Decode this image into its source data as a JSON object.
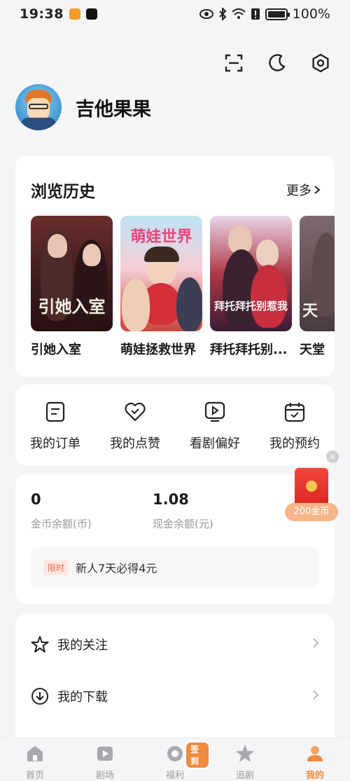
{
  "status_bar": {
    "time": "19:38",
    "battery": "100%"
  },
  "profile": {
    "username": "吉他果果"
  },
  "history": {
    "title": "浏览历史",
    "more_label": "更多",
    "items": [
      {
        "caption": "引她入室",
        "poster_text": "引她入室"
      },
      {
        "caption": "萌娃拯救世界",
        "poster_text": "萌娃世界"
      },
      {
        "caption": "拜托拜托别...",
        "poster_text": "拜托拜托别惹我"
      },
      {
        "caption": "天堂",
        "poster_text": "天"
      }
    ]
  },
  "quick_actions": [
    {
      "label": "我的订单",
      "icon": "order-icon"
    },
    {
      "label": "我的点赞",
      "icon": "heart-icon"
    },
    {
      "label": "看剧偏好",
      "icon": "play-icon"
    },
    {
      "label": "我的预约",
      "icon": "calendar-icon"
    }
  ],
  "wallet": {
    "coins_value": "0",
    "coins_label": "金币余额(币)",
    "cash_value": "1.08",
    "cash_label": "现金余额(元)",
    "promo_tag": "限时",
    "promo_text": "新人7天必得4元"
  },
  "red_packet": {
    "amount": "200金币",
    "close": "×"
  },
  "menu": [
    {
      "label": "我的关注",
      "icon": "star-icon"
    },
    {
      "label": "我的下载",
      "icon": "download-icon"
    }
  ],
  "tabbar": {
    "items": [
      {
        "label": "首页",
        "icon": "home-icon"
      },
      {
        "label": "剧场",
        "icon": "theater-icon"
      },
      {
        "label": "福利",
        "icon": "coin-icon",
        "badge": "签到"
      },
      {
        "label": "追剧",
        "icon": "star-icon"
      },
      {
        "label": "我的",
        "icon": "user-icon",
        "active": true
      }
    ]
  },
  "colors": {
    "accent": "#f08a3e",
    "background": "#f5f5f7",
    "card": "#ffffff"
  }
}
